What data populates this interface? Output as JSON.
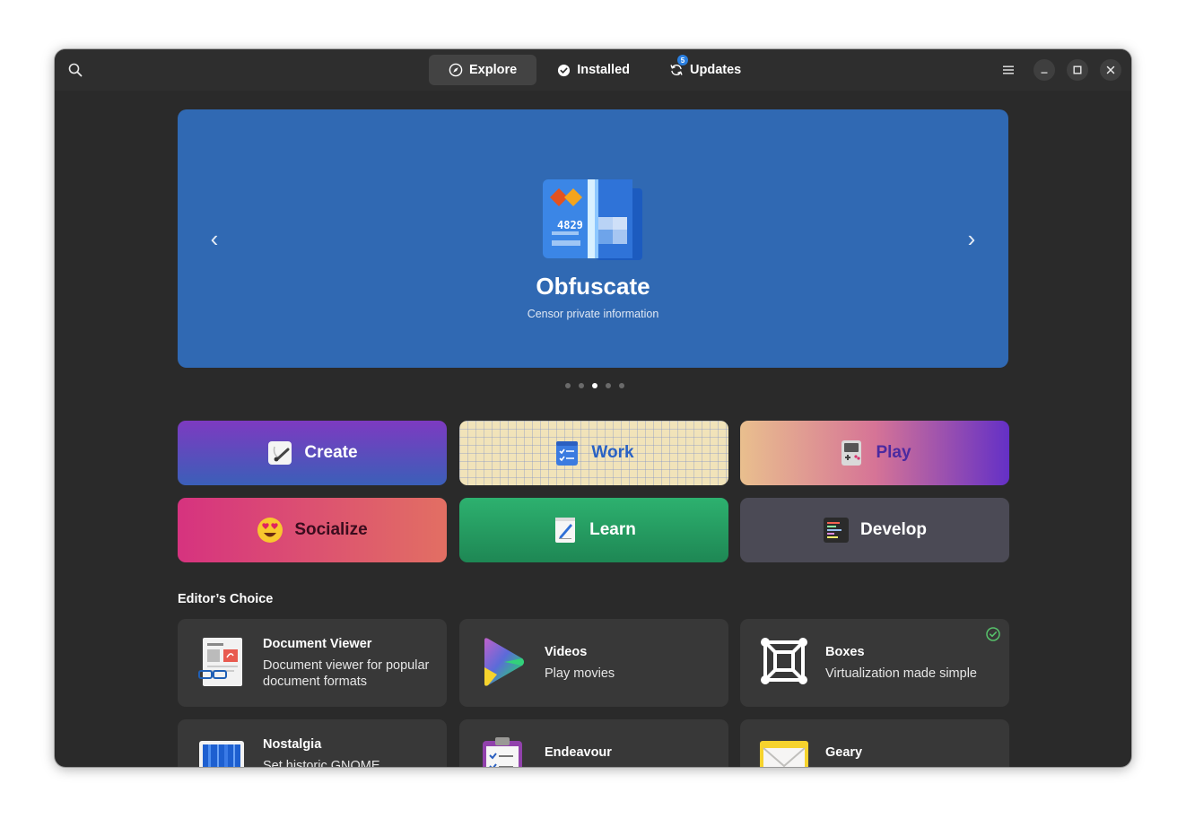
{
  "header": {
    "tabs": [
      {
        "label": "Explore",
        "active": true,
        "icon": "compass-icon"
      },
      {
        "label": "Installed",
        "active": false,
        "icon": "check-circle-icon"
      },
      {
        "label": "Updates",
        "active": false,
        "icon": "refresh-icon",
        "badge": "5"
      }
    ]
  },
  "featured": {
    "title": "Obfuscate",
    "subtitle": "Censor private information",
    "icon_text": "4829",
    "background": "#3069b3",
    "slide_count": 5,
    "active_slide": 3
  },
  "categories": [
    {
      "label": "Create",
      "icon": "paintbrush-icon"
    },
    {
      "label": "Work",
      "icon": "checklist-icon"
    },
    {
      "label": "Play",
      "icon": "gamepad-icon"
    },
    {
      "label": "Socialize",
      "icon": "heart-eyes-emoji-icon"
    },
    {
      "label": "Learn",
      "icon": "notebook-pencil-icon"
    },
    {
      "label": "Develop",
      "icon": "code-editor-icon"
    }
  ],
  "editors_choice": {
    "title": "Editor’s Choice",
    "apps": [
      {
        "name": "Document Viewer",
        "description": "Document viewer for popular document formats",
        "icon": "document-viewer-icon",
        "installed": false
      },
      {
        "name": "Videos",
        "description": "Play movies",
        "icon": "videos-play-icon",
        "installed": false
      },
      {
        "name": "Boxes",
        "description": "Virtualization made simple",
        "icon": "boxes-icon",
        "installed": true
      },
      {
        "name": "Nostalgia",
        "description": "Set historic GNOME",
        "icon": "nostalgia-icon",
        "installed": false
      },
      {
        "name": "Endeavour",
        "description": "",
        "icon": "clipboard-tasks-icon",
        "installed": false
      },
      {
        "name": "Geary",
        "description": "",
        "icon": "envelope-icon",
        "installed": false
      }
    ]
  },
  "colors": {
    "window_bg": "#2a2a2a",
    "card_bg": "#383838",
    "accent": "#2a7fe0",
    "installed_check": "#57c26b"
  }
}
